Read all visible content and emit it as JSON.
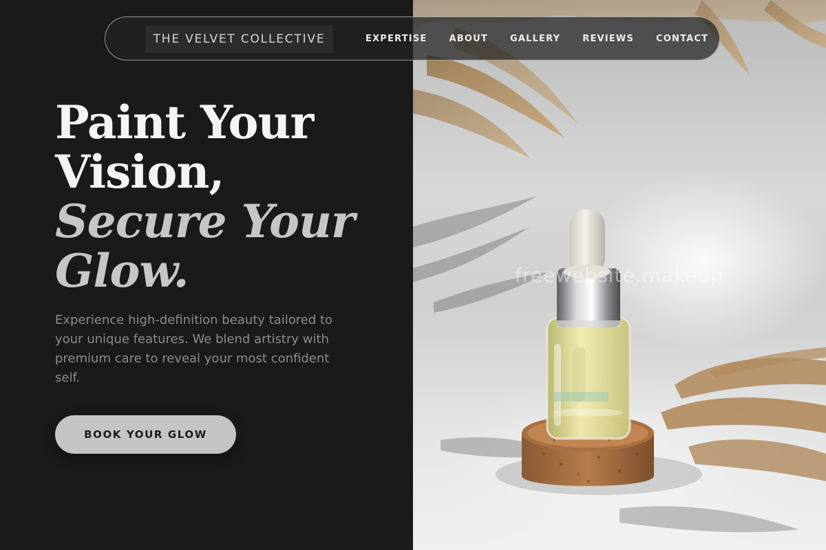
{
  "brand": {
    "name": "THE VELVET COLLECTIVE"
  },
  "nav": {
    "items": [
      {
        "label": "EXPERTISE"
      },
      {
        "label": "ABOUT"
      },
      {
        "label": "GALLERY"
      },
      {
        "label": "REVIEWS"
      },
      {
        "label": "CONTACT"
      }
    ]
  },
  "hero": {
    "headline": {
      "line1": "Paint Your",
      "line2": "Vision,",
      "line3": "Secure Your",
      "line4": "Glow."
    },
    "description": "Experience high-definition beauty tailored to your unique features. We blend artistry with premium care to reveal your most confident self.",
    "cta_label": "BOOK YOUR GLOW"
  },
  "image": {
    "subject": "serum dropper bottle on cork stand",
    "watermark": "freewebsite.makeup"
  },
  "colors": {
    "background_dark": "#1a1a1a",
    "headline_solid": "#f4f4f4",
    "headline_italic": "#c6c6c6",
    "body_text": "#8c8c8c",
    "cta_background": "#c4c4c4",
    "cta_text": "#1b1b1b"
  }
}
